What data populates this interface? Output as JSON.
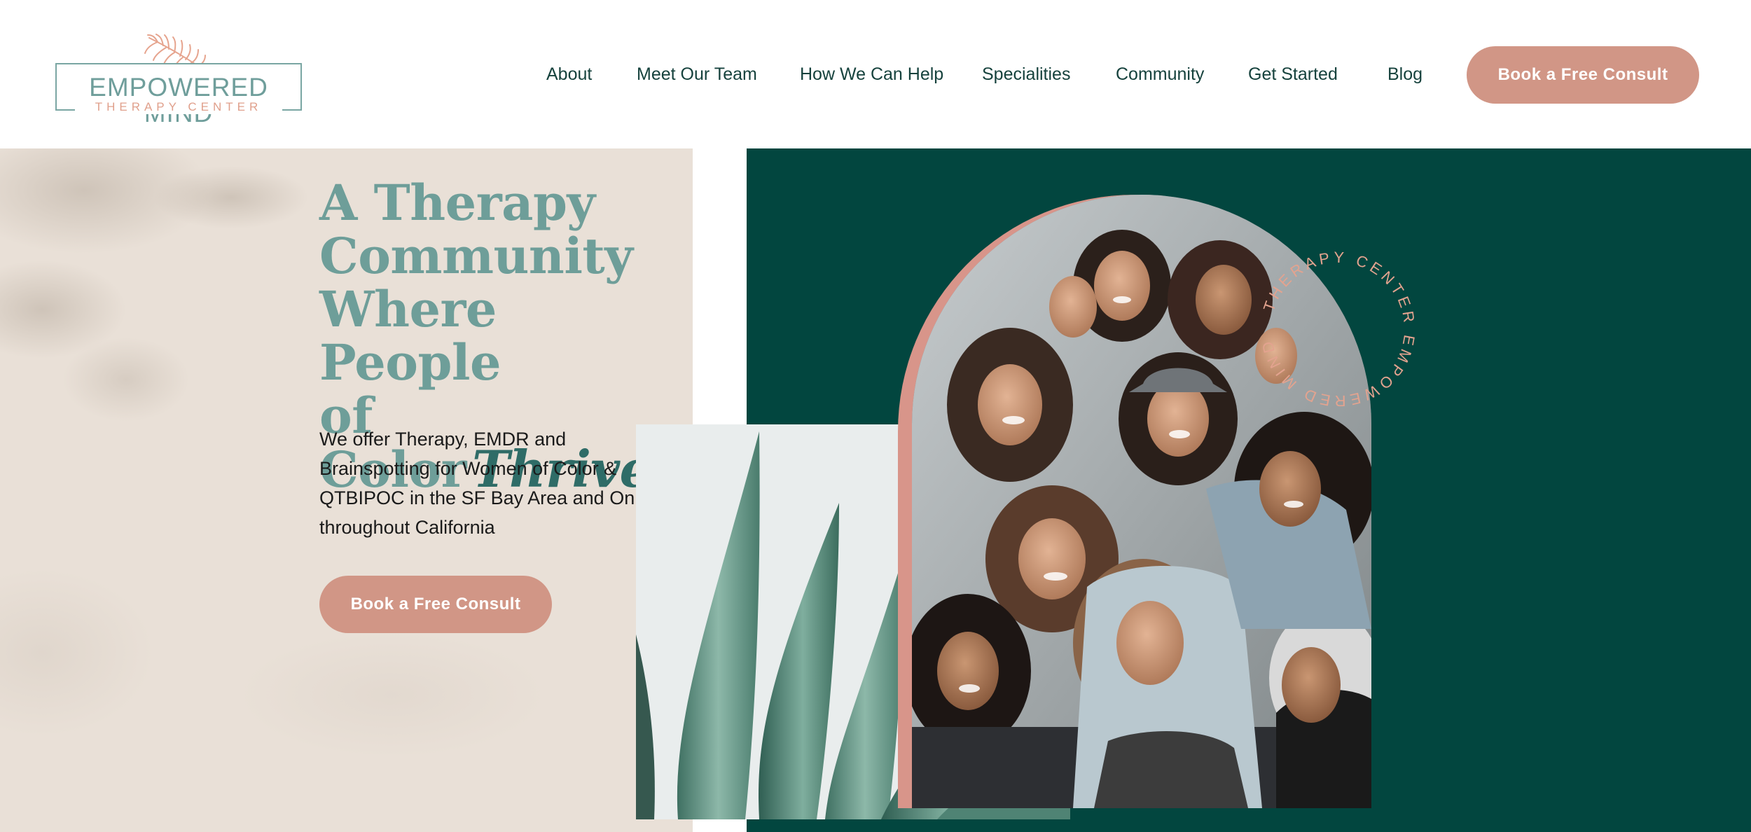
{
  "logo": {
    "name": "EMPOWERED MIND",
    "subtitle": "THERAPY CENTER"
  },
  "nav": {
    "items": [
      {
        "label": "About"
      },
      {
        "label": "Meet Our Team"
      },
      {
        "label": "How We Can Help"
      },
      {
        "label": "Specialities"
      },
      {
        "label": "Community"
      },
      {
        "label": "Get Started"
      },
      {
        "label": "Blog"
      }
    ],
    "cta_label": "Book a Free Consult"
  },
  "hero": {
    "headline_lines": [
      "A Therapy",
      "Community",
      "Where People",
      "of Color"
    ],
    "headline_script": "Thrive",
    "intro_lines": [
      "We offer Therapy, EMDR and",
      "Brainspotting for Women of Color &",
      "QTBIPOC in the SF Bay Area and Online",
      "throughout California"
    ],
    "cta_label": "Book a Free Consult",
    "ring_text": "THERAPY CENTER EMPOWERED MIND"
  },
  "colors": {
    "accent": "#d19686",
    "teal_dark": "#02463f",
    "teal_heading": "#6e9e99",
    "sand": "#e9e0d7",
    "nav_text": "#16423d"
  },
  "icons": {
    "logo_mark": "leaf-icon"
  }
}
